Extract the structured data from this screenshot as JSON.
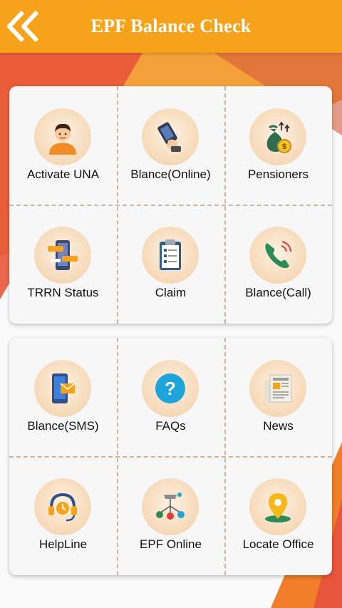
{
  "header": {
    "title": "EPF Balance Check"
  },
  "colors": {
    "header": "#f7a21b",
    "accent_red": "#e8553a",
    "accent_orange": "#f3a03a"
  },
  "grid1": [
    {
      "label": "Activate UNA",
      "icon": "person-icon"
    },
    {
      "label": "Blance(Online)",
      "icon": "phone-hand-icon"
    },
    {
      "label": "Pensioners",
      "icon": "money-bag-icon"
    },
    {
      "label": "TRRN Status",
      "icon": "mobile-status-icon"
    },
    {
      "label": "Claim",
      "icon": "clipboard-icon"
    },
    {
      "label": "Blance(Call)",
      "icon": "phone-call-icon"
    }
  ],
  "grid2": [
    {
      "label": "Blance(SMS)",
      "icon": "sms-icon"
    },
    {
      "label": "FAQs",
      "icon": "question-icon"
    },
    {
      "label": "News",
      "icon": "newspaper-icon"
    },
    {
      "label": "HelpLine",
      "icon": "headset-icon"
    },
    {
      "label": "EPF Online",
      "icon": "network-icon"
    },
    {
      "label": "Locate Office",
      "icon": "location-pin-icon"
    }
  ]
}
